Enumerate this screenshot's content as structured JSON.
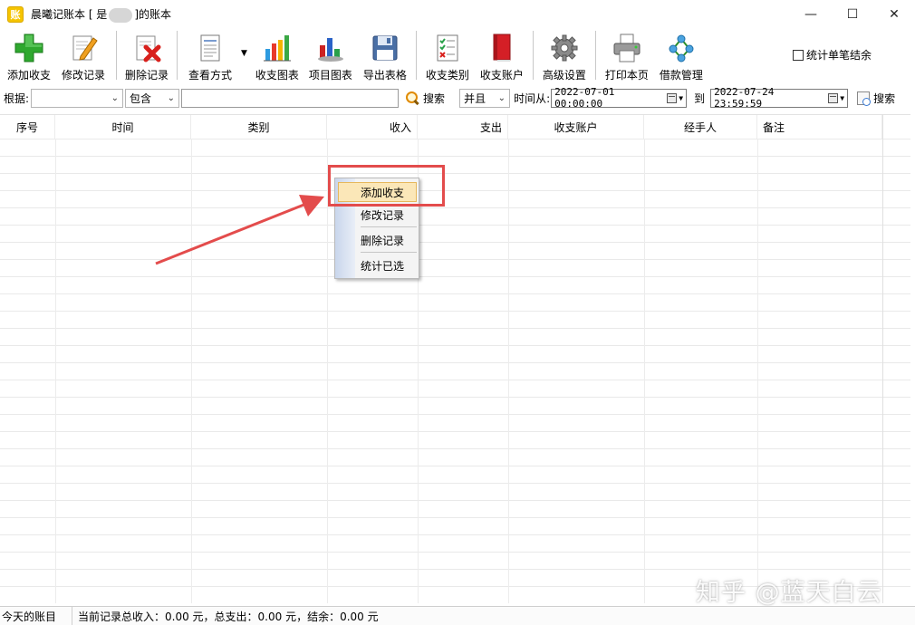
{
  "window": {
    "app_icon_glyph": "账",
    "title_prefix": "晨曦记账本    [ 是",
    "title_suffix": "]的账本",
    "minimize": "—",
    "maximize": "☐",
    "close": "✕"
  },
  "toolbar": {
    "buttons": [
      {
        "label": "添加收支",
        "icon": "add-plus-icon"
      },
      {
        "label": "修改记录",
        "icon": "edit-pencil-icon"
      },
      {
        "label": "删除记录",
        "icon": "delete-x-icon"
      },
      {
        "label": "查看方式",
        "icon": "view-document-icon"
      },
      {
        "label": "收支图表",
        "icon": "bar-chart-icon"
      },
      {
        "label": "项目图表",
        "icon": "project-chart-icon"
      },
      {
        "label": "导出表格",
        "icon": "export-table-icon"
      },
      {
        "label": "收支类别",
        "icon": "category-list-icon"
      },
      {
        "label": "收支账户",
        "icon": "account-book-icon"
      },
      {
        "label": "高级设置",
        "icon": "gear-icon"
      },
      {
        "label": "打印本页",
        "icon": "printer-icon"
      },
      {
        "label": "借款管理",
        "icon": "loan-network-icon"
      }
    ],
    "stat_single": "统计单笔结余"
  },
  "filter": {
    "basis_label": "根据:",
    "basis_value": "",
    "match_value": "包含",
    "keyword_value": "",
    "search_label": "搜索",
    "logic_value": "并且",
    "time_from_label": "时间从:",
    "time_from_value": "2022-07-01 00:00:00",
    "to_label": "到",
    "time_to_value": "2022-07-24 23:59:59",
    "search2_label": "搜索"
  },
  "grid": {
    "columns": [
      "序号",
      "时间",
      "类别",
      "收入",
      "支出",
      "收支账户",
      "经手人",
      "备注"
    ]
  },
  "context_menu": {
    "items": [
      "添加收支",
      "修改记录",
      "删除记录",
      "统计已选"
    ]
  },
  "watermark": "知乎 @蓝天白云",
  "status": {
    "left": "今天的账目",
    "summary": "当前记录总收入：0.00 元，总支出：0.00 元，结余：0.00 元"
  },
  "colors": {
    "highlight_box": "#e34c4c",
    "menu_highlight": "#fbe7b8"
  }
}
